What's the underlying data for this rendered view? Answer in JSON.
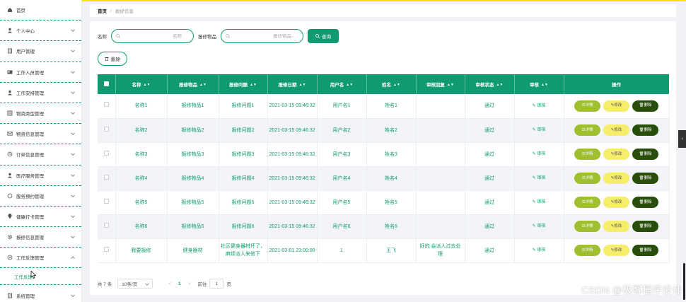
{
  "sidebar": {
    "items": [
      {
        "label": "首页",
        "icon": "home-icon",
        "chevron": false
      },
      {
        "label": "个人中心",
        "icon": "user-icon",
        "chevron": true
      },
      {
        "label": "用户管理",
        "icon": "file-icon",
        "chevron": true
      },
      {
        "label": "工作人员管理",
        "icon": "id-card-icon",
        "chevron": true
      },
      {
        "label": "工作安排管理",
        "icon": "user-icon",
        "chevron": true
      },
      {
        "label": "物资类型管理",
        "icon": "grid-icon",
        "chevron": true
      },
      {
        "label": "物资信息管理",
        "icon": "mail-icon",
        "chevron": true
      },
      {
        "label": "订单信息管理",
        "icon": "clock-icon",
        "chevron": true
      },
      {
        "label": "医疗服务管理",
        "icon": "user-icon",
        "chevron": true
      },
      {
        "label": "服务预约管理",
        "icon": "circle-icon",
        "chevron": true
      },
      {
        "label": "健康打卡管理",
        "icon": "pin-icon",
        "chevron": true
      },
      {
        "label": "报修信息管理",
        "icon": "gear-icon",
        "chevron": true
      },
      {
        "label": "工作反馈管理",
        "icon": "compass-icon",
        "chevron": true,
        "expanded": true
      }
    ],
    "submenu_label": "工作反馈",
    "last_item": {
      "label": "系统管理",
      "icon": "file-icon"
    }
  },
  "breadcrumb": {
    "home": "首页",
    "separator": "/",
    "current": "报修信息"
  },
  "search": {
    "name_label": "名称",
    "name_placeholder": "名称",
    "item_label": "报修物品",
    "item_placeholder": "报修物品",
    "query_button": "查询"
  },
  "delete_button": "删除",
  "table": {
    "headers": [
      "名称",
      "报修物品",
      "报修问题",
      "报修日期",
      "用户名",
      "姓名",
      "审核回复",
      "审核状态",
      "审核",
      "操作"
    ],
    "audit_label": "审核",
    "op_labels": {
      "detail": "详情",
      "edit": "修改",
      "delete": "删除"
    },
    "rows": [
      {
        "name": "名称1",
        "item": "报修物品1",
        "issue": "报修问题1",
        "date": "2021-03-15 09:46:32",
        "username": "用户名1",
        "realname": "姓名1",
        "reply": "",
        "status": "通过"
      },
      {
        "name": "名称2",
        "item": "报修物品2",
        "issue": "报修问题2",
        "date": "2021-03-15 09:46:32",
        "username": "用户名2",
        "realname": "姓名2",
        "reply": "",
        "status": "通过"
      },
      {
        "name": "名称3",
        "item": "报修物品3",
        "issue": "报修问题3",
        "date": "2021-03-15 09:46:32",
        "username": "用户名3",
        "realname": "姓名3",
        "reply": "",
        "status": "通过"
      },
      {
        "name": "名称4",
        "item": "报修物品4",
        "issue": "报修问题4",
        "date": "2021-03-15 09:46:32",
        "username": "用户名4",
        "realname": "姓名4",
        "reply": "",
        "status": "通过"
      },
      {
        "name": "名称5",
        "item": "报修物品5",
        "issue": "报修问题5",
        "date": "2021-03-15 09:46:32",
        "username": "用户名5",
        "realname": "姓名5",
        "reply": "",
        "status": "通过"
      },
      {
        "name": "名称6",
        "item": "报修物品6",
        "issue": "报修问题6",
        "date": "2021-03-15 09:46:32",
        "username": "用户名6",
        "realname": "姓名6",
        "reply": "",
        "status": "通过"
      },
      {
        "name": "我要报修",
        "item": "健身器材",
        "issue": "社区健身器材坏了，麻烦派人来修下",
        "date": "2021-03-01 23:00:00",
        "username": "1",
        "realname": "王飞",
        "reply": "好的 会派人过去处理",
        "status": "通过"
      }
    ]
  },
  "pager": {
    "total": "共 7 条",
    "page_size": "10条/页",
    "prev": "<",
    "current": "1",
    "next": ">",
    "goto": "前往",
    "goto_value": "1",
    "page_unit": "页"
  },
  "watermark": "CSDN @极客程序设计",
  "colors": {
    "primary": "#0f9a72",
    "detail_btn": "#9fbf2f",
    "edit_btn": "#f6ee6a",
    "delete_btn": "#294d0b"
  }
}
